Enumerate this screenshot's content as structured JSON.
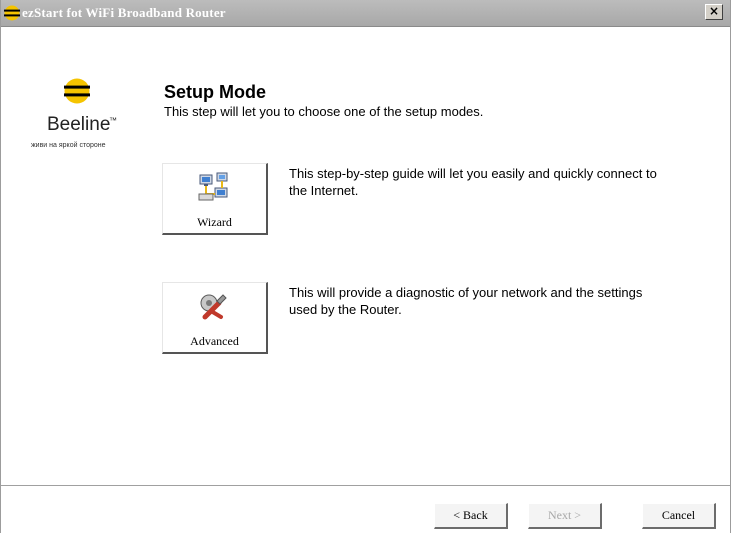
{
  "window": {
    "title": "ezStart fot WiFi Broadband Router",
    "close_label": "×"
  },
  "logo": {
    "name": "Beeline",
    "tm": "™",
    "slogan": "живи на яркой стороне",
    "colors": {
      "yellow": "#f5c400",
      "black": "#000000"
    }
  },
  "page": {
    "heading": "Setup Mode",
    "subheading": "This step will let you to choose one of the setup modes."
  },
  "modes": [
    {
      "label": "Wizard",
      "icon": "network-computers-icon",
      "description": "This step-by-step guide will let you easily and quickly connect to the Internet."
    },
    {
      "label": "Advanced",
      "icon": "wrench-tools-icon",
      "description": "This will provide a diagnostic of your network and the settings used by the Router."
    }
  ],
  "footer": {
    "back_label": "< Back",
    "next_label": "Next >",
    "next_enabled": false,
    "cancel_label": "Cancel"
  }
}
